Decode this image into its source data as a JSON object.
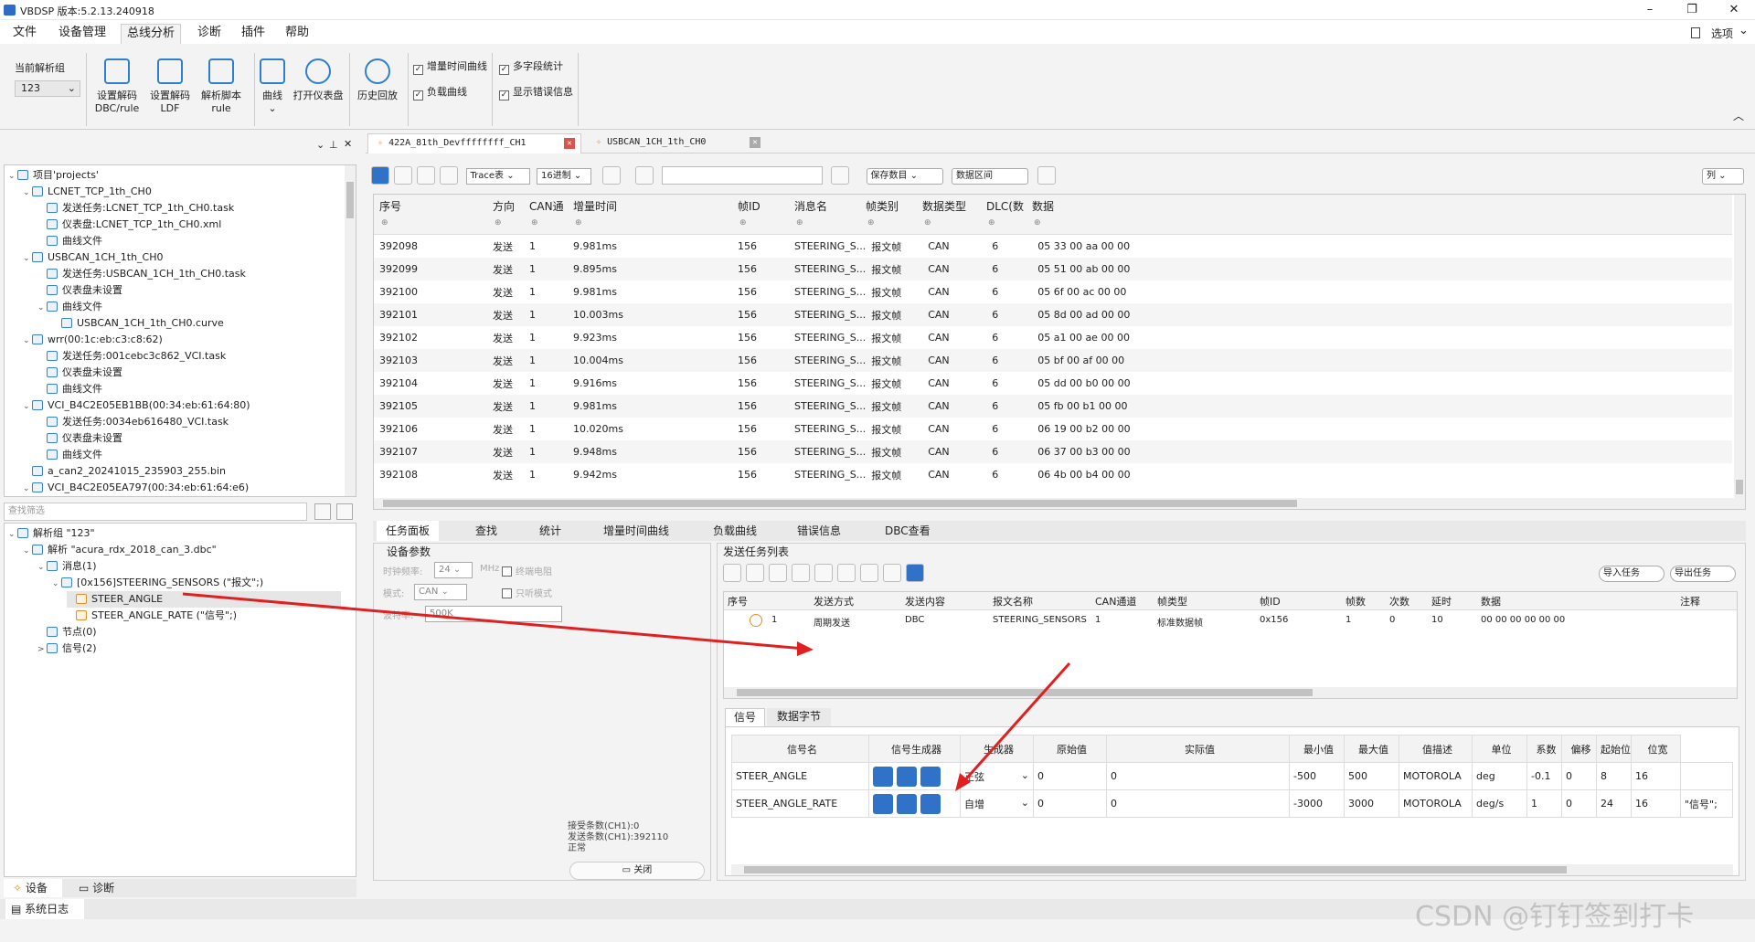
{
  "window": {
    "title": "VBDSP 版本:5.2.13.240918",
    "minimize": "–",
    "maximize": "❐",
    "close": "✕",
    "pin": "▯",
    "simplify": "选项"
  },
  "menu": [
    "文件",
    "设备管理",
    "总线分析",
    "诊断",
    "插件",
    "帮助"
  ],
  "ribbon": {
    "group_label": "当前解析组",
    "group_value": "123",
    "buttons": [
      {
        "l1": "设置解码",
        "l2": "DBC/rule"
      },
      {
        "l1": "设置解码",
        "l2": "LDF"
      },
      {
        "l1": "解析脚本",
        "l2": "rule"
      },
      {
        "l1": "曲线",
        "l2": "⌄"
      },
      {
        "l1": "打开仪表盘",
        "l2": ""
      },
      {
        "l1": "历史回放",
        "l2": ""
      }
    ],
    "checks": [
      "增量时间曲线",
      "负载曲线",
      "多字段统计",
      "显示错误信息"
    ]
  },
  "tree": [
    {
      "d": 0,
      "a": "⌄",
      "t": "项目'projects'"
    },
    {
      "d": 1,
      "a": "⌄",
      "t": "LCNET_TCP_1th_CH0"
    },
    {
      "d": 2,
      "a": "",
      "t": "发送任务:LCNET_TCP_1th_CH0.task"
    },
    {
      "d": 2,
      "a": "",
      "t": "仪表盘:LCNET_TCP_1th_CH0.xml"
    },
    {
      "d": 2,
      "a": "",
      "t": "曲线文件"
    },
    {
      "d": 1,
      "a": "⌄",
      "t": "USBCAN_1CH_1th_CH0"
    },
    {
      "d": 2,
      "a": "",
      "t": "发送任务:USBCAN_1CH_1th_CH0.task"
    },
    {
      "d": 2,
      "a": "",
      "t": "仪表盘未设置"
    },
    {
      "d": 2,
      "a": "⌄",
      "t": "曲线文件"
    },
    {
      "d": 3,
      "a": "",
      "t": "USBCAN_1CH_1th_CH0.curve"
    },
    {
      "d": 1,
      "a": "⌄",
      "t": "wrr(00:1c:eb:c3:c8:62)"
    },
    {
      "d": 2,
      "a": "",
      "t": "发送任务:001cebc3c862_VCI.task"
    },
    {
      "d": 2,
      "a": "",
      "t": "仪表盘未设置"
    },
    {
      "d": 2,
      "a": "",
      "t": "曲线文件"
    },
    {
      "d": 1,
      "a": "⌄",
      "t": "VCI_B4C2E05EB1BB(00:34:eb:61:64:80)"
    },
    {
      "d": 2,
      "a": "",
      "t": "发送任务:0034eb616480_VCI.task"
    },
    {
      "d": 2,
      "a": "",
      "t": "仪表盘未设置"
    },
    {
      "d": 2,
      "a": "",
      "t": "曲线文件"
    },
    {
      "d": 1,
      "a": "",
      "t": "a_can2_20241015_235903_255.bin"
    },
    {
      "d": 1,
      "a": "⌄",
      "t": "VCI_B4C2E05EA797(00:34:eb:61:64:e6)"
    }
  ],
  "filter_placeholder": "查找筛选",
  "parse_tree": [
    {
      "d": 0,
      "a": "⌄",
      "t": "解析组 \"123\""
    },
    {
      "d": 1,
      "a": "⌄",
      "t": "解析 \"acura_rdx_2018_can_3.dbc\""
    },
    {
      "d": 2,
      "a": "⌄",
      "t": "消息(1)"
    },
    {
      "d": 3,
      "a": "⌄",
      "t": "[0x156]STEERING_SENSORS (\"报文\";)"
    },
    {
      "d": 4,
      "a": "",
      "t": "STEER_ANGLE"
    },
    {
      "d": 4,
      "a": "",
      "t": "STEER_ANGLE_RATE (\"信号\";)"
    },
    {
      "d": 2,
      "a": "",
      "t": "节点(0)"
    },
    {
      "d": 2,
      "a": ">",
      "t": "信号(2)"
    }
  ],
  "left_tabs": [
    "设备",
    "诊断"
  ],
  "syslog": "系统日志",
  "doc_tabs": [
    "422A_81th_Devffffffff_CH1",
    "USBCAN_1CH_1th_CH0"
  ],
  "toolbar": {
    "trace": "Trace表",
    "radix": "16进制",
    "save": "保存数目",
    "range": "数据区间",
    "cols": "列"
  },
  "grid": {
    "headers": [
      "序号",
      "方向",
      "CAN通",
      "增量时间",
      "帧ID",
      "消息名",
      "帧类别",
      "数据类型",
      "DLC(数",
      "数据"
    ],
    "rows": [
      [
        "392098",
        "发送",
        "1",
        "9.981ms",
        "156",
        "STEERING_S...",
        "报文帧",
        "CAN",
        "6",
        "05 33 00 aa 00 00"
      ],
      [
        "392099",
        "发送",
        "1",
        "9.895ms",
        "156",
        "STEERING_S...",
        "报文帧",
        "CAN",
        "6",
        "05 51 00 ab 00 00"
      ],
      [
        "392100",
        "发送",
        "1",
        "9.981ms",
        "156",
        "STEERING_S...",
        "报文帧",
        "CAN",
        "6",
        "05 6f 00 ac 00 00"
      ],
      [
        "392101",
        "发送",
        "1",
        "10.003ms",
        "156",
        "STEERING_S...",
        "报文帧",
        "CAN",
        "6",
        "05 8d 00 ad 00 00"
      ],
      [
        "392102",
        "发送",
        "1",
        "9.923ms",
        "156",
        "STEERING_S...",
        "报文帧",
        "CAN",
        "6",
        "05 a1 00 ae 00 00"
      ],
      [
        "392103",
        "发送",
        "1",
        "10.004ms",
        "156",
        "STEERING_S...",
        "报文帧",
        "CAN",
        "6",
        "05 bf 00 af 00 00"
      ],
      [
        "392104",
        "发送",
        "1",
        "9.916ms",
        "156",
        "STEERING_S...",
        "报文帧",
        "CAN",
        "6",
        "05 dd 00 b0 00 00"
      ],
      [
        "392105",
        "发送",
        "1",
        "9.981ms",
        "156",
        "STEERING_S...",
        "报文帧",
        "CAN",
        "6",
        "05 fb 00 b1 00 00"
      ],
      [
        "392106",
        "发送",
        "1",
        "10.020ms",
        "156",
        "STEERING_S...",
        "报文帧",
        "CAN",
        "6",
        "06 19 00 b2 00 00"
      ],
      [
        "392107",
        "发送",
        "1",
        "9.948ms",
        "156",
        "STEERING_S...",
        "报文帧",
        "CAN",
        "6",
        "06 37 00 b3 00 00"
      ],
      [
        "392108",
        "发送",
        "1",
        "9.942ms",
        "156",
        "STEERING_S...",
        "报文帧",
        "CAN",
        "6",
        "06 4b 00 b4 00 00"
      ]
    ]
  },
  "bottom_tabs": [
    "任务面板",
    "查找",
    "统计",
    "增量时间曲线",
    "负载曲线",
    "错误信息",
    "DBC查看"
  ],
  "device": {
    "title": "设备参数",
    "clock_label": "时钟频率:",
    "clock": "24",
    "mhz": "MHz",
    "term": "终端电阻",
    "mode_label": "模式:",
    "mode": "CAN",
    "listen": "只听模式",
    "baud_label": "波特率:",
    "baud": "500K",
    "status": [
      "接受条数(CH1):0",
      "发送条数(CH1):392110",
      "正常"
    ],
    "close": "关闭"
  },
  "task": {
    "title": "发送任务列表",
    "import": "导入任务",
    "export": "导出任务",
    "headers": [
      "序号",
      "发送方式",
      "发送内容",
      "报文名称",
      "CAN通道",
      "帧类型",
      "帧ID",
      "帧数",
      "次数",
      "延时",
      "数据",
      "注释"
    ],
    "row": [
      "1",
      "周期发送",
      "DBC",
      "STEERING_SENSORS",
      "1",
      "标准数据帧",
      "0x156",
      "1",
      "0",
      "10",
      "00 00 00 00 00 00",
      ""
    ]
  },
  "sig_tabs": [
    "信号",
    "数据字节"
  ],
  "signals": {
    "headers": [
      "信号名",
      "信号生成器",
      "生成器",
      "原始值",
      "实际值",
      "最小值",
      "最大值",
      "值描述",
      "单位",
      "系数",
      "偏移",
      "起始位",
      "位宽"
    ],
    "rows": [
      [
        "STEER_ANGLE",
        "正弦",
        "0",
        "0",
        "-500",
        "500",
        "MOTOROLA",
        "deg",
        "-0.1",
        "0",
        "8",
        "16",
        ""
      ],
      [
        "STEER_ANGLE_RATE",
        "自增",
        "0",
        "0",
        "-3000",
        "3000",
        "MOTOROLA",
        "deg/s",
        "1",
        "0",
        "24",
        "16",
        "\"信号\";"
      ]
    ]
  },
  "watermark": "CSDN @钉钉签到打卡"
}
